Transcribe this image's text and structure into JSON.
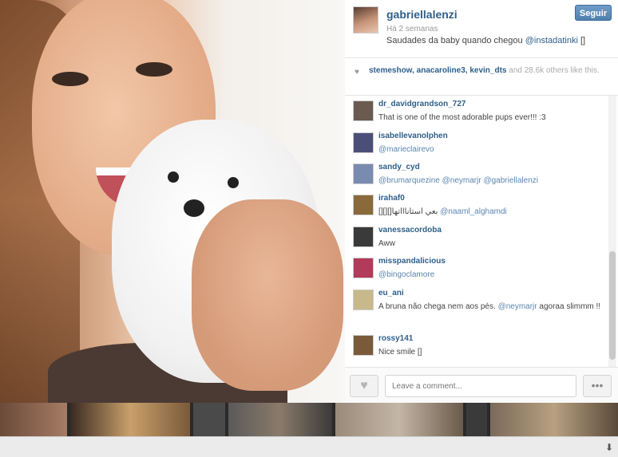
{
  "post": {
    "author": "gabriellalenzi",
    "time": "Há 2 semanas",
    "caption_text": "Saudades da baby quando chegou ",
    "caption_mention": "@instadatinki",
    "caption_tail": " []",
    "follow_label": "Seguir"
  },
  "likes": {
    "users": "stemeshow, anacaroline3, kevin_dts",
    "rest": " and 28.6k others like this."
  },
  "comments": [
    {
      "user": "dr_davidgrandson_727",
      "text": "That is one of the most adorable pups ever!!! :3",
      "mention": "",
      "avatar_color": "#6b5a50"
    },
    {
      "user": "isabellevanolphen",
      "text": "",
      "mention": "@marieclairevo",
      "avatar_color": "#4b4f78"
    },
    {
      "user": "sandy_cyd",
      "text": "",
      "mention": "@brumarquezine @neymarjr @gabriellalenzi",
      "avatar_color": "#7a8bb0"
    },
    {
      "user": "irahaf0",
      "text": "[][][]بعي استاناااتها ",
      "mention": "@naaml_alghamdi",
      "avatar_color": "#8a6a3a"
    },
    {
      "user": "vanessacordoba",
      "text": "Aww",
      "mention": "",
      "avatar_color": "#3a3a3a"
    },
    {
      "user": "misspandalicious",
      "text": "",
      "mention": "@bingoclamore",
      "avatar_color": "#b23a5a"
    },
    {
      "user": "eu_ani",
      "text": "A bruna não chega nem aos pés. ",
      "mention": "@neymarjr",
      "text2": " agoraa slimmm !!",
      "avatar_color": "#c7b98a"
    },
    {
      "user": "rossy141",
      "text": "Nice smile []",
      "mention": "",
      "avatar_color": "#7a5a3a"
    }
  ],
  "comment_input": {
    "placeholder": "Leave a comment..."
  },
  "icons": {
    "heart": "heart-icon",
    "more": "more-options-icon",
    "download": "download-arrow-icon"
  },
  "colors": {
    "link": "#2d5f8a",
    "follow_button": "#4f7fae"
  }
}
